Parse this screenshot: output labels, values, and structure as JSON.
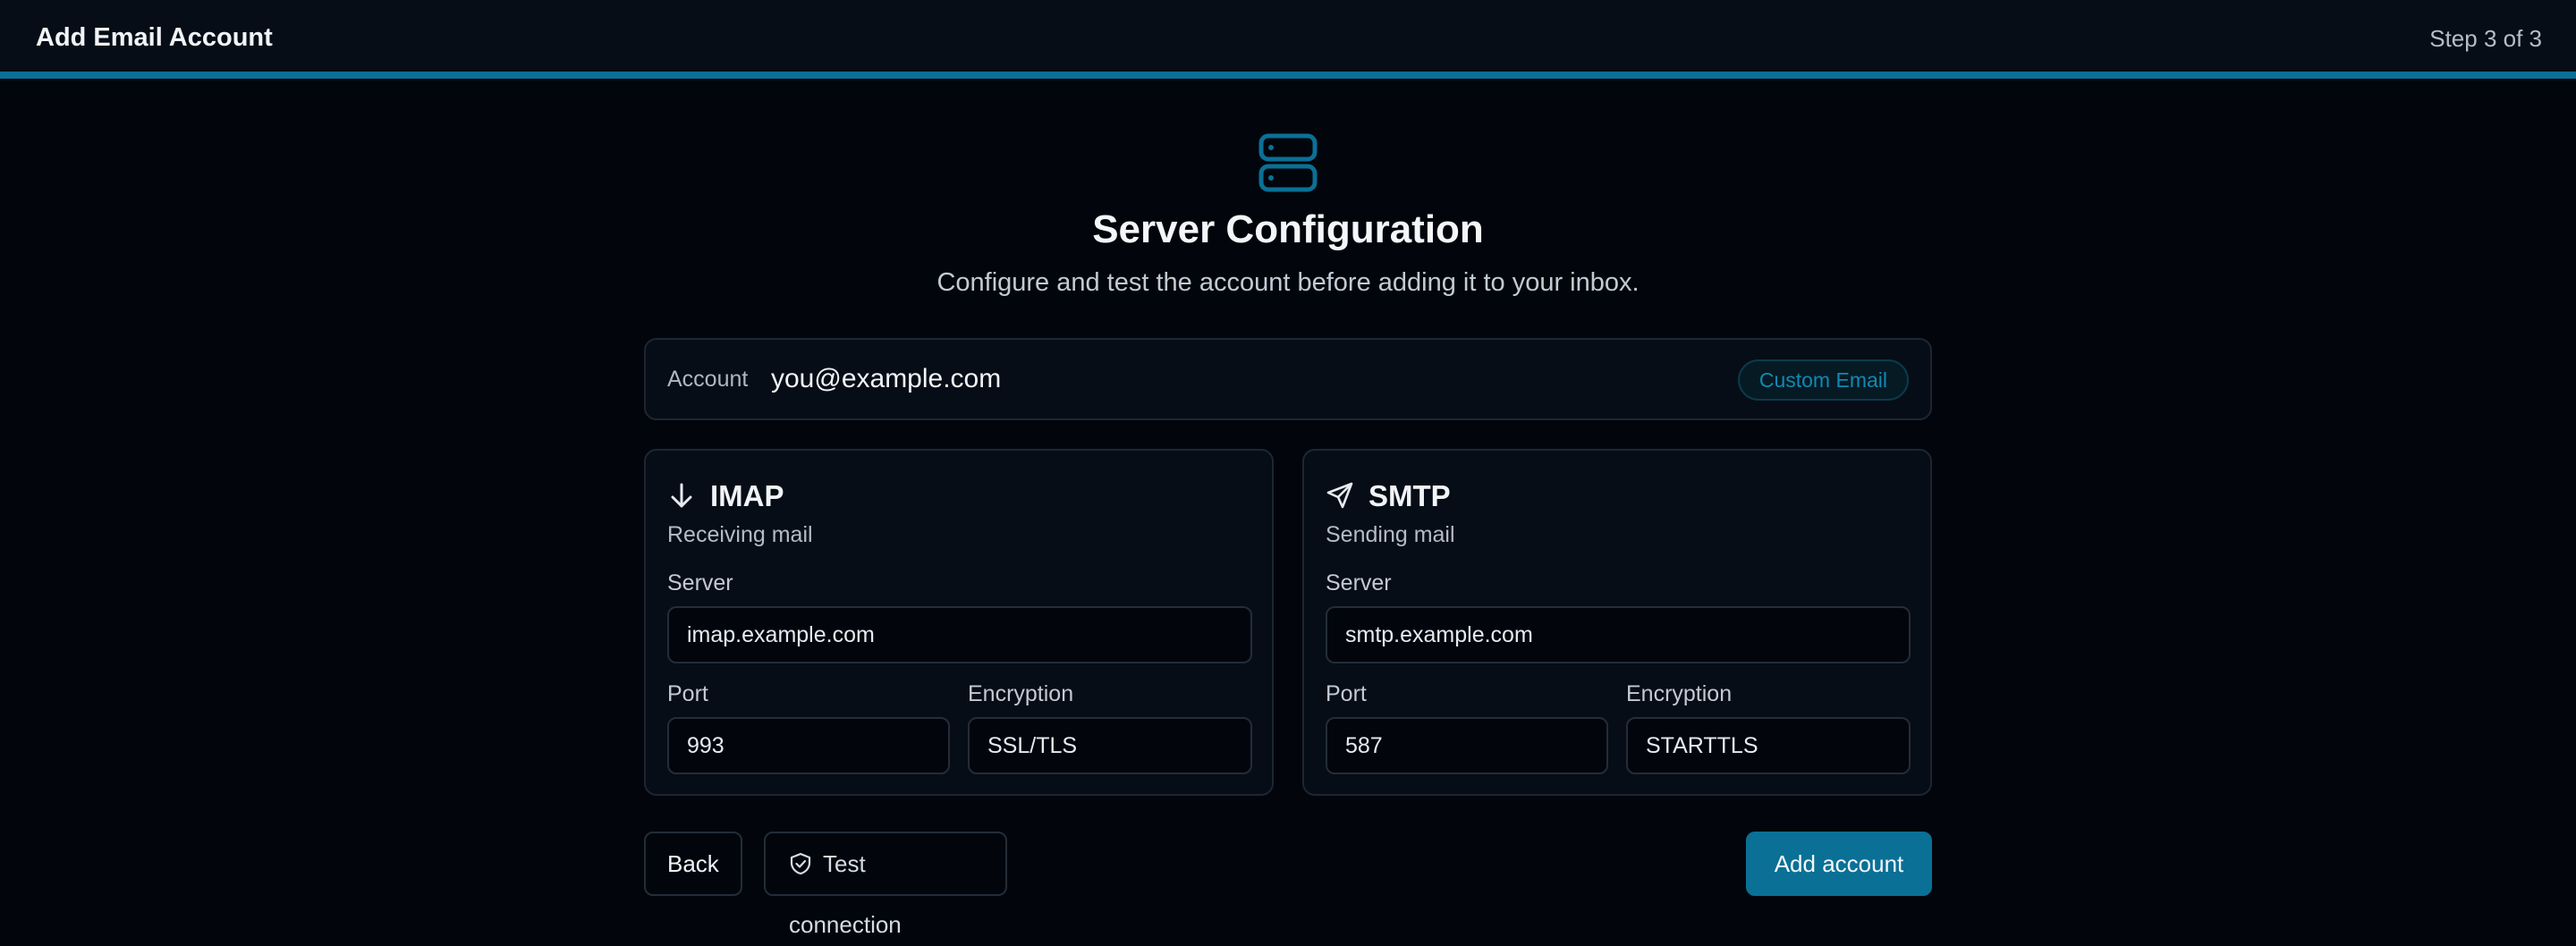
{
  "header": {
    "title": "Add Email Account",
    "step": "Step 3 of 3"
  },
  "hero": {
    "icon": "server-icon",
    "title": "Server Configuration",
    "subtitle": "Configure and test the account before adding it to your inbox."
  },
  "account": {
    "label": "Account",
    "email": "you@example.com",
    "badge": "Custom Email"
  },
  "imap": {
    "icon": "arrow-down-icon",
    "title": "IMAP",
    "subtitle": "Receiving mail",
    "server_label": "Server",
    "server": "imap.example.com",
    "port_label": "Port",
    "port": "993",
    "encryption_label": "Encryption",
    "encryption": "SSL/TLS"
  },
  "smtp": {
    "icon": "send-icon",
    "title": "SMTP",
    "subtitle": "Sending mail",
    "server_label": "Server",
    "server": "smtp.example.com",
    "port_label": "Port",
    "port": "587",
    "encryption_label": "Encryption",
    "encryption": "STARTTLS"
  },
  "actions": {
    "back": "Back",
    "test": "Test connection",
    "test_icon": "shield-check-icon",
    "add": "Add account"
  },
  "colors": {
    "accent": "#0a7096",
    "background": "#02060c",
    "card": "#070d16"
  }
}
